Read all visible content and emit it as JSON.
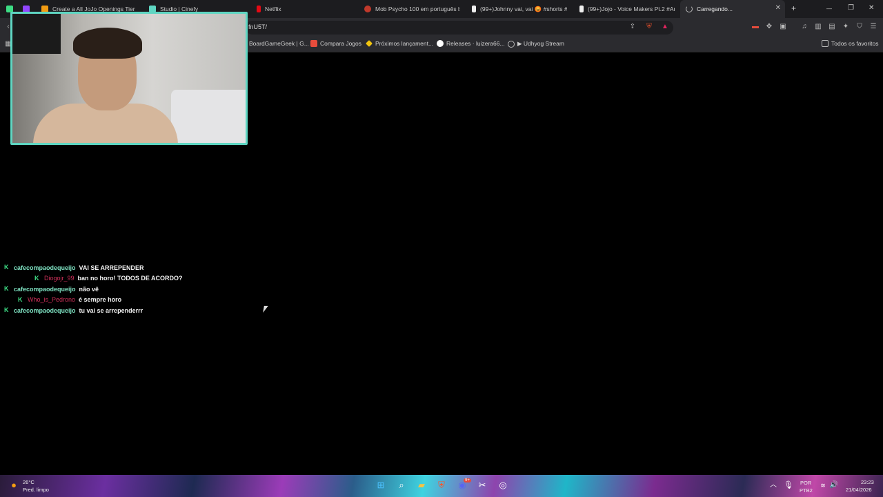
{
  "tabs": [
    {
      "title": "",
      "color": "#3ddc84"
    },
    {
      "title": "",
      "color": "#9146ff"
    },
    {
      "title": "Create a All JoJo Openings Tier List",
      "color": "#f39c12"
    },
    {
      "title": "Studio | Cinefy",
      "color": "#5fd6c2"
    },
    {
      "title": "Netflix",
      "color": "#e50914"
    },
    {
      "title": "Mob Psycho 100 em português bra",
      "color": "#c0392b"
    },
    {
      "title": "(99+)Johnny vai, vai 😡 #shorts #sl",
      "color": "#eeeeee"
    },
    {
      "title": "(99+)Jojo - Voice Makers Pt.2 #An",
      "color": "#eeeeee"
    },
    {
      "title": "Carregando...",
      "color": "#bbbbbb"
    }
  ],
  "address": {
    "url": "fnU5T/"
  },
  "bookmarks": [
    {
      "label": "BoardGameGeek | G...",
      "color": "#ff6b35"
    },
    {
      "label": "Compara Jogos",
      "color": "#e74c3c"
    },
    {
      "label": "Próximos lançament...",
      "color": "#f1c40f"
    },
    {
      "label": "Releases · luizera66...",
      "color": "#ffffff"
    },
    {
      "label": "▶ Udhyog Stream",
      "color": "#bbbbbb"
    },
    {
      "label": "Todos os favoritos",
      "color": "#bbbbbb"
    }
  ],
  "chat": [
    {
      "user": "cafecompaodequeijo",
      "text": "VAI SE ARREPENDER",
      "color": "#7fe3c3",
      "indent": 0
    },
    {
      "user": "Diogojr_99",
      "text": "ban no horo! TODOS DE ACORDO?",
      "color": "#d0315a",
      "indent": 1
    },
    {
      "user": "cafecompaodequeijo",
      "text": "não vê",
      "color": "#7fe3c3",
      "indent": 0
    },
    {
      "user": "Who_is_Pedrono",
      "text": "é sempre horo",
      "color": "#d0315a",
      "indent": 2
    },
    {
      "user": "cafecompaodequeijo",
      "text": "tu vai se arrependerrr",
      "color": "#7fe3c3",
      "indent": 0
    }
  ],
  "chat_badge": "K",
  "taskbar": {
    "weather_temp": "26°C",
    "weather_desc": "Pred. limpo",
    "lang_top": "POR",
    "lang_bottom": "PTB2",
    "time": "23:23",
    "date": "21/04/2026",
    "discord_badge": "9+"
  },
  "glyphs": {
    "new_tab": "+",
    "minimize": "—",
    "maximize": "❐",
    "close": "✕",
    "tab_close": "✕"
  }
}
